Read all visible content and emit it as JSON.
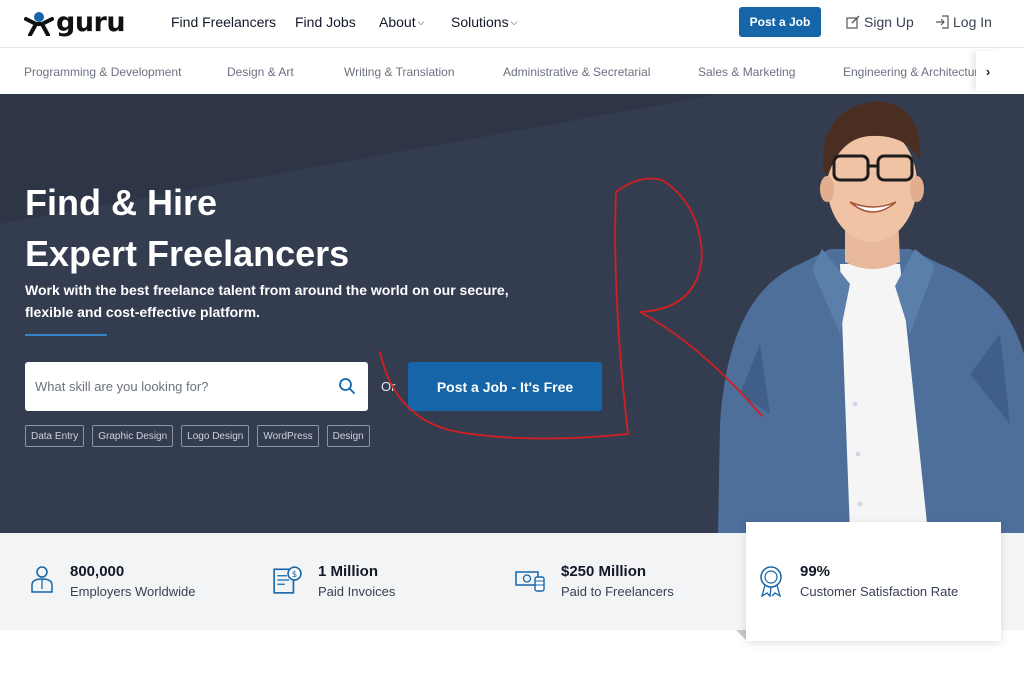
{
  "brand": {
    "logo_text": "guru"
  },
  "nav": {
    "find_freelancers": "Find Freelancers",
    "find_jobs": "Find Jobs",
    "about": "About",
    "solutions": "Solutions",
    "post_job": "Post a Job",
    "sign_up": "Sign Up",
    "log_in": "Log In"
  },
  "categories": [
    "Programming & Development",
    "Design & Art",
    "Writing & Translation",
    "Administrative & Secretarial",
    "Sales & Marketing",
    "Engineering & Architecture"
  ],
  "hero": {
    "title_line1": "Find & Hire",
    "title_line2": "Expert Freelancers",
    "subtitle_line1": "Work with the best freelance talent from around the world on our secure,",
    "subtitle_line2": "flexible and cost-effective platform.",
    "search_placeholder": "What skill are you looking for?",
    "or_text": "Or",
    "cta": "Post a Job - It's Free",
    "tags": [
      "Data Entry",
      "Graphic Design",
      "Logo Design",
      "WordPress",
      "Design"
    ]
  },
  "stats": [
    {
      "value": "800,000",
      "label": "Employers Worldwide",
      "icon": "employer-icon"
    },
    {
      "value": "1 Million",
      "label": "Paid Invoices",
      "icon": "invoice-icon"
    },
    {
      "value": "$250 Million",
      "label": "Paid to Freelancers",
      "icon": "money-icon"
    },
    {
      "value": "99%",
      "label": "Customer Satisfaction Rate",
      "icon": "award-icon"
    }
  ],
  "colors": {
    "primary": "#1565a8",
    "hero_bg": "#2e3547",
    "stats_bg": "#f3f4f6",
    "annotation": "#d21f1f"
  }
}
